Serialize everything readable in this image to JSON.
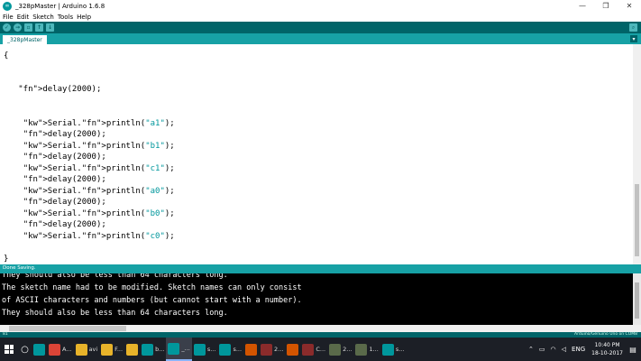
{
  "window": {
    "title": "_328pMaster | Arduino 1.6.8",
    "icon": "infinity-icon",
    "minimize": "—",
    "restore": "❐",
    "close": "✕"
  },
  "menu": [
    "File",
    "Edit",
    "Sketch",
    "Tools",
    "Help"
  ],
  "toolbar": {
    "verify": "✓",
    "upload": "→",
    "new": "▫",
    "open": "↑",
    "save": "↓",
    "serial_monitor": "⌕"
  },
  "tab": {
    "name": "_328pMaster",
    "menu_glyph": "▾"
  },
  "editor": {
    "code_lines": [
      "  ",
      "{",
      "",
      "",
      "   delay(2000);",
      "",
      "",
      "    Serial.println(\"a1\");",
      "    delay(2000);",
      "    Serial.println(\"b1\");",
      "    delay(2000);",
      "    Serial.println(\"c1\");",
      "    delay(2000);",
      "    Serial.println(\"a0\");",
      "    delay(2000);",
      "    Serial.println(\"b0\");",
      "    delay(2000);",
      "    Serial.println(\"c0\");",
      "",
      "}"
    ]
  },
  "status": {
    "message": "Done Saving."
  },
  "console": {
    "lines": [
      "They should also be less than 64 characters long.",
      "The sketch name had to be modified. Sketch names can only consist",
      "of ASCII characters and numbers (but cannot start with a number).",
      "They should also be less than 64 characters long."
    ]
  },
  "boardbar": {
    "line": "81",
    "board": "Arduino/Genuino Uno on COM8"
  },
  "taskbar": {
    "items": [
      {
        "icon": "arduino-icon",
        "label": "",
        "color": "#00979c"
      },
      {
        "icon": "chrome-icon",
        "label": "A...",
        "color": "#db4437"
      },
      {
        "icon": "folder-icon",
        "label": "avi",
        "color": "#e8b32a"
      },
      {
        "icon": "folder-icon",
        "label": "F...",
        "color": "#e8b32a"
      },
      {
        "icon": "folder-icon",
        "label": "",
        "color": "#e8b32a"
      },
      {
        "icon": "arduino-icon",
        "label": "b...",
        "color": "#00979c"
      },
      {
        "icon": "arduino-icon",
        "label": "_...",
        "color": "#00979c"
      },
      {
        "icon": "arduino-icon",
        "label": "s...",
        "color": "#00979c"
      },
      {
        "icon": "arduino-icon",
        "label": "s...",
        "color": "#00979c"
      },
      {
        "icon": "app-icon",
        "label": "",
        "color": "#d35400"
      },
      {
        "icon": "window-icon",
        "label": "2...",
        "color": "#8b2b2b"
      },
      {
        "icon": "app-icon",
        "label": "",
        "color": "#d35400"
      },
      {
        "icon": "window-icon",
        "label": "C...",
        "color": "#8b2b2b"
      },
      {
        "icon": "window-icon",
        "label": "2...",
        "color": "#5a6a4a"
      },
      {
        "icon": "window-icon",
        "label": "1...",
        "color": "#5a6a4a"
      },
      {
        "icon": "arduino-icon",
        "label": "s...",
        "color": "#00979c"
      }
    ],
    "lang": "ENG",
    "time": "10:40 PM",
    "date": "18-10-2017"
  }
}
